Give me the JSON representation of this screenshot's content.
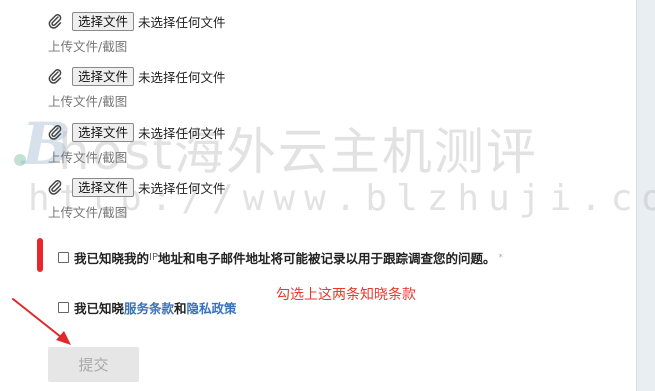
{
  "uploads": [
    {
      "button_label": "选择文件",
      "status": "未选择任何文件",
      "hint": "上传文件/截图"
    },
    {
      "button_label": "选择文件",
      "status": "未选择任何文件",
      "hint": "上传文件/截图"
    },
    {
      "button_label": "选择文件",
      "status": "未选择任何文件",
      "hint": "上传文件/截图"
    },
    {
      "button_label": "选择文件",
      "status": "未选择任何文件",
      "hint": "上传文件/截图"
    }
  ],
  "watermark": {
    "logo_letter": "B",
    "title": "host海外云主机测评",
    "url": "http://www.blzhuji.com/"
  },
  "consent": {
    "ip_prefix": "我已知晓我的",
    "ip_word": "IP",
    "ip_suffix": "地址和电子邮件地址将可能被记录以用于跟踪调查您的问题。",
    "required_mark": "*",
    "terms_prefix": "我已知晓",
    "terms_link": "服务条款",
    "and_word": "和",
    "privacy_link": "隐私政策"
  },
  "annotation": "勾选上这两条知晓条款",
  "submit_label": "提交",
  "colors": {
    "annotation": "#e83a2f",
    "link": "#3a72b8",
    "red_mark": "#e8262b"
  }
}
